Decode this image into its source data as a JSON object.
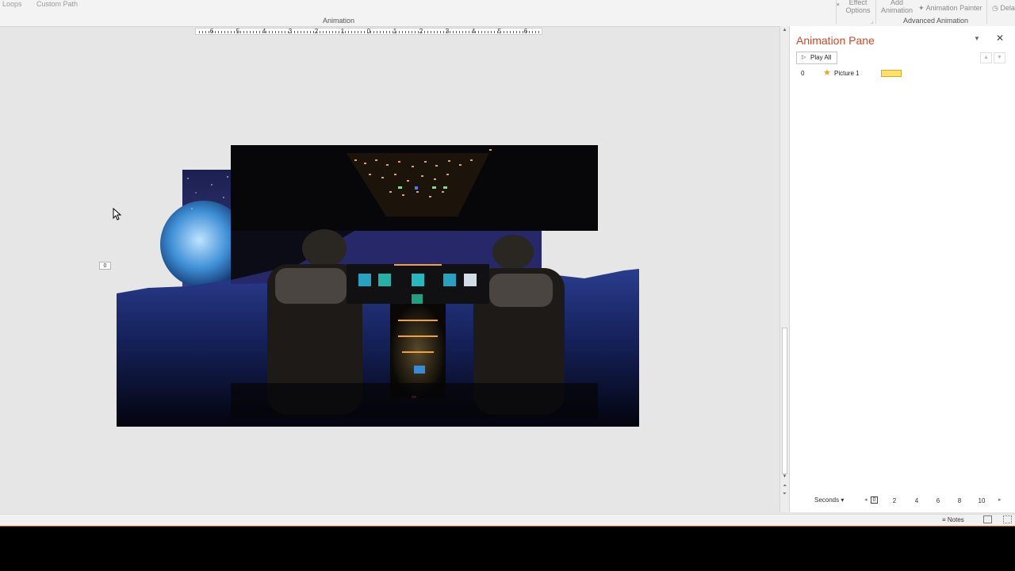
{
  "ribbon": {
    "effect_items": [
      "Loops",
      "Custom Path"
    ],
    "group_animation": "Animation",
    "effect_options": "Effect Options",
    "add_animation": "Add Animation",
    "animation_painter": "Animation Painter",
    "group_advanced": "Advanced Animation",
    "delay_partial": "Dela"
  },
  "ruler": {
    "labels": [
      "6",
      "5",
      "4",
      "3",
      "2",
      "1",
      "0",
      "1",
      "2",
      "3",
      "4",
      "5",
      "6"
    ]
  },
  "slide": {
    "animation_tag": "0"
  },
  "animation_pane": {
    "title": "Animation Pane",
    "play_all": "Play All",
    "items": [
      {
        "index": "0",
        "name": "Picture 1",
        "color": "#ffe06b"
      }
    ],
    "timeline": {
      "unit": "Seconds",
      "first": "0",
      "ticks": [
        "2",
        "4",
        "6",
        "8",
        "10"
      ]
    }
  },
  "status_bar": {
    "notes": "Notes"
  },
  "colors": {
    "accent": "#d24726",
    "star": "#e6a430"
  }
}
